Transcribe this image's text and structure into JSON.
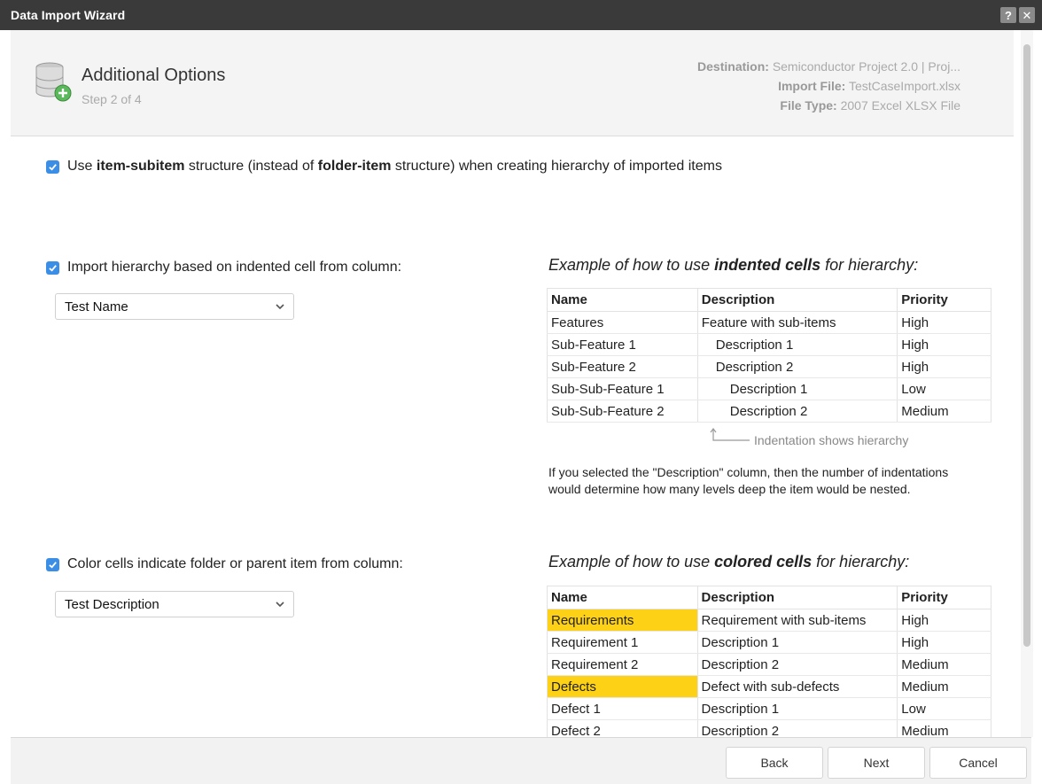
{
  "window": {
    "title": "Data Import Wizard",
    "help_label": "?",
    "close_label": "✕"
  },
  "header": {
    "title": "Additional Options",
    "step": "Step 2 of 4",
    "destination_label": "Destination:",
    "destination_value": "Semiconductor Project 2.0 | Proj...",
    "import_file_label": "Import File:",
    "import_file_value": "TestCaseImport.xlsx",
    "file_type_label": "File Type:",
    "file_type_value": "2007 Excel XLSX File"
  },
  "options": {
    "structure": {
      "checked": true,
      "t1": "Use ",
      "b1": "item-subitem",
      "t2": " structure (instead of ",
      "b2": "folder-item",
      "t3": " structure) when creating hierarchy of imported items"
    },
    "indented": {
      "checked": true,
      "label": "Import hierarchy based on indented cell from column:",
      "selected": "Test Name"
    },
    "colored": {
      "checked": true,
      "label": "Color cells indicate folder or parent item from column:",
      "selected": "Test Description"
    }
  },
  "indent_example": {
    "h1": "Example of how to use ",
    "hb": "indented cells",
    "h2": " for hierarchy:",
    "columns": [
      "Name",
      "Description",
      "Priority"
    ],
    "rows": [
      [
        "Features",
        "Feature with sub-items",
        "High"
      ],
      [
        "Sub-Feature 1",
        "Description 1",
        "High"
      ],
      [
        "Sub-Feature 2",
        "Description 2",
        "High"
      ],
      [
        "Sub-Sub-Feature 1",
        "Description 1",
        "Low"
      ],
      [
        "Sub-Sub-Feature 2",
        "Description 2",
        "Medium"
      ]
    ],
    "note": "Indentation shows hierarchy",
    "explain": "If you selected the \"Description\" column, then the number of indentations would determine how many levels deep the item would be nested."
  },
  "color_example": {
    "h1": "Example of how to use ",
    "hb": "colored cells",
    "h2": " for hierarchy:",
    "columns": [
      "Name",
      "Description",
      "Priority"
    ],
    "highlight_color": "#fcd116",
    "rows": [
      [
        "Requirements",
        "Requirement with sub-items",
        "High"
      ],
      [
        "Requirement 1",
        "Description 1",
        "High"
      ],
      [
        "Requirement 2",
        "Description 2",
        "Medium"
      ],
      [
        "Defects",
        "Defect with sub-defects",
        "Medium"
      ],
      [
        "Defect 1",
        "Description 1",
        "Low"
      ],
      [
        "Defect 2",
        "Description 2",
        "Medium"
      ]
    ]
  },
  "footer": {
    "back": "Back",
    "next": "Next",
    "cancel": "Cancel"
  },
  "colors": {
    "titlebar": "#3a3a3a",
    "checkbox": "#3b8ee6",
    "highlight": "#fcd116"
  }
}
